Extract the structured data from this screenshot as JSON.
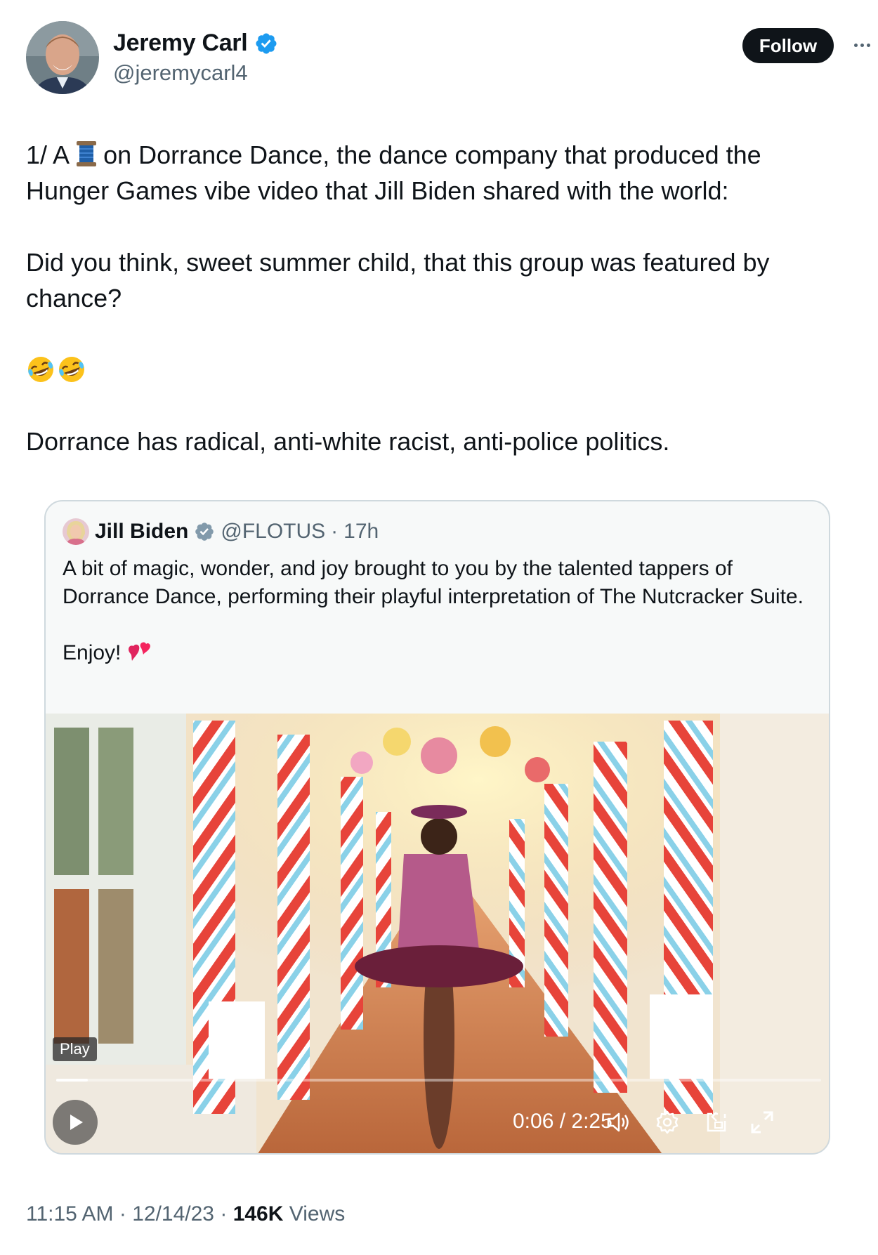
{
  "author": {
    "name": "Jeremy Carl",
    "handle": "@jeremycarl4",
    "follow_label": "Follow"
  },
  "tweet": {
    "line1_prefix": "1/  A",
    "line1_suffix": "on Dorrance Dance, the dance company that produced the Hunger Games vibe video that Jill Biden shared with the world:",
    "para2": "Did you think, sweet summer child, that this group was featured by chance?",
    "para3": "Dorrance has radical, anti-white racist, anti-police politics."
  },
  "quoted": {
    "name": "Jill Biden",
    "handle": "@FLOTUS",
    "separator": "·",
    "time": "17h",
    "text1": "A bit of magic, wonder, and joy brought to you by the talented tappers of Dorrance Dance, performing their playful interpretation of The Nutcracker Suite.",
    "text2": "Enjoy!"
  },
  "video": {
    "play_label": "Play",
    "timecode": "0:06 / 2:25",
    "progress": 0.041
  },
  "footer": {
    "time": "11:15 AM",
    "sep1": "·",
    "date": "12/14/23",
    "sep2": "·",
    "views_count": "146K",
    "views_label": "Views"
  },
  "colors": {
    "verified": "#1d9bf0",
    "text": "#0f1419",
    "muted": "#536471",
    "border": "#cfd9de"
  },
  "icons": {
    "verified": "verified-badge-icon",
    "more": "more-icon",
    "spool": "spool-of-thread-emoji",
    "laughing": "rolling-on-floor-laughing-emoji",
    "heart": "two-hearts-emoji",
    "play": "play-icon",
    "volume": "volume-icon",
    "settings": "gear-icon",
    "pip": "picture-in-picture-icon",
    "fullscreen": "fullscreen-icon"
  }
}
